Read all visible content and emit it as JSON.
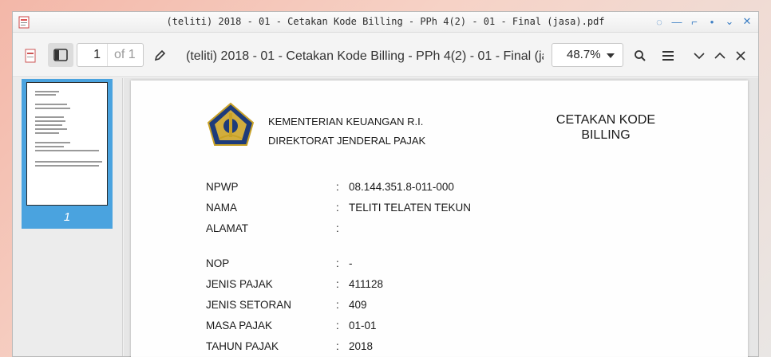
{
  "window": {
    "title": "(teliti) 2018 - 01 - Cetakan Kode Billing - PPh 4(2) - 01 - Final (jasa).pdf"
  },
  "toolbar": {
    "page_number": "1",
    "page_of": "of 1",
    "document_title": "(teliti) 2018 - 01 - Cetakan Kode Billing - PPh 4(2) - 01 - Final (jasa).pdf",
    "zoom": "48.7%"
  },
  "thumbnails": [
    {
      "label": "1"
    }
  ],
  "document": {
    "org_line1": "KEMENTERIAN KEUANGAN R.I.",
    "org_line2": "DIREKTORAT JENDERAL PAJAK",
    "heading_line1": "CETAKAN KODE",
    "heading_line2": "BILLING",
    "fields": [
      {
        "label": "NPWP",
        "sep": ":",
        "value": "08.144.351.8-011-000"
      },
      {
        "label": "NAMA",
        "sep": ":",
        "value": "TELITI TELATEN TEKUN"
      },
      {
        "label": "ALAMAT",
        "sep": ":",
        "value": ""
      },
      {
        "label": "NOP",
        "sep": ":",
        "value": "-"
      },
      {
        "label": "JENIS PAJAK",
        "sep": ":",
        "value": "411128"
      },
      {
        "label": "JENIS SETORAN",
        "sep": ":",
        "value": "409"
      },
      {
        "label": "MASA PAJAK",
        "sep": ":",
        "value": "01-01"
      },
      {
        "label": "TAHUN PAJAK",
        "sep": ":",
        "value": "2018"
      }
    ]
  },
  "colors": {
    "accent": "#4aa3df",
    "window_controls": "#3d7fc4"
  }
}
